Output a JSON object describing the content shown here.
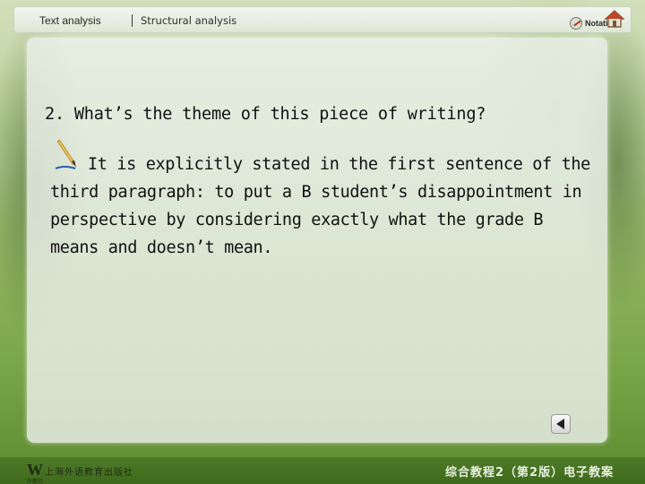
{
  "topbar": {
    "tab_text_analysis": "Text analysis",
    "tab_structural_analysis": "Structural analysis",
    "notation_label": "Notation"
  },
  "content": {
    "question": "2. What’s the theme of this piece of writing?",
    "answer": "It is explicitly stated in the first sentence of the third paragraph: to put a B student’s disappointment in perspective by considering exactly what the grade B means and doesn’t mean."
  },
  "footer": {
    "publisher": "上海外语教育出版社",
    "publisher_sub": "外教社",
    "book_title": "综合教程2（第2版）电子教案"
  },
  "colors": {
    "background": "#8fb35f",
    "footer": "#4d7a27",
    "panel": "#ecf0ec"
  },
  "icons": [
    "pen-icon",
    "notation-icon",
    "home-icon",
    "back-arrow-icon",
    "publisher-logo"
  ]
}
